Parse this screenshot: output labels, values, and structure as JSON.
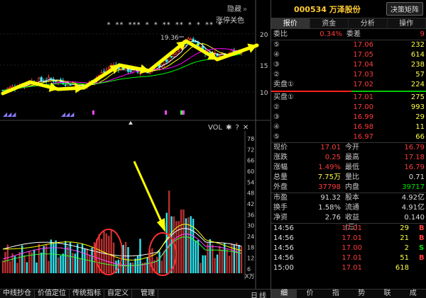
{
  "chart": {
    "hidden_label": "隐藏",
    "limit_label": "涨停关色",
    "stars": "* **  *** * * **  ** *     *     **     *",
    "peak_label": "19.36",
    "price_axis": [
      "20",
      "15",
      "10"
    ],
    "vol_label": "VOL",
    "vol_gear": "✱",
    "vol_q": "?",
    "vol_x": "✕",
    "vol_axis": [
      "78",
      "72",
      "66",
      "60",
      "54",
      "48",
      "42",
      "36",
      "30",
      "24",
      "18",
      "12",
      "6"
    ],
    "vol_unit": "X万"
  },
  "bottom_tabs": [
    "中线抄仓",
    "价值定位",
    "传统指标",
    "自定义",
    "管理"
  ],
  "day_week": [
    "日",
    "线"
  ],
  "panel": {
    "stock_code": "000534",
    "stock_name": "万泽股份",
    "head_button": "决策矩阵",
    "tabs": [
      "报价",
      "资金",
      "分析",
      "操作"
    ],
    "ratio": {
      "label": "委比",
      "value": "0.34%",
      "label2": "委差",
      "value2": "9"
    },
    "asks": [
      {
        "label": "⑤",
        "price": "17.06",
        "vol": "232"
      },
      {
        "label": "④",
        "price": "17.05",
        "vol": "614"
      },
      {
        "label": "③",
        "price": "17.04",
        "vol": "238"
      },
      {
        "label": "②",
        "price": "17.03",
        "vol": "57"
      },
      {
        "label": "卖盘①",
        "price": "17.02",
        "vol": "224"
      }
    ],
    "bids": [
      {
        "label": "买盘①",
        "price": "17.01",
        "vol": "275"
      },
      {
        "label": "②",
        "price": "17.00",
        "vol": "993"
      },
      {
        "label": "③",
        "price": "16.99",
        "vol": "29"
      },
      {
        "label": "④",
        "price": "16.98",
        "vol": "11"
      },
      {
        "label": "⑤",
        "price": "16.97",
        "vol": "66"
      }
    ],
    "quote1": [
      {
        "l1": "现价",
        "v1": "17.01",
        "c1": "red",
        "l2": "今开",
        "v2": "16.79",
        "c2": "red"
      },
      {
        "l1": "涨跌",
        "v1": "0.25",
        "c1": "red",
        "l2": "最高",
        "v2": "17.18",
        "c2": "red"
      },
      {
        "l1": "涨幅",
        "v1": "1.49%",
        "c1": "red",
        "l2": "最低",
        "v2": "16.79",
        "c2": "red"
      },
      {
        "l1": "总量",
        "v1": "7.75万",
        "c1": "yellow",
        "l2": "量比",
        "v2": "0.71",
        "c2": "white"
      },
      {
        "l1": "外盘",
        "v1": "37798",
        "c1": "red",
        "l2": "内盘",
        "v2": "39717",
        "c2": "green"
      }
    ],
    "quote2": [
      {
        "l1": "市盈",
        "v1": "91.32",
        "c1": "white",
        "l2": "股本",
        "v2": "4.92亿",
        "c2": "white"
      },
      {
        "l1": "换手",
        "v1": "1.58%",
        "c1": "white",
        "l2": "流通",
        "v2": "4.91亿",
        "c2": "white"
      },
      {
        "l1": "净资",
        "v1": "2.76",
        "c1": "white",
        "l2": "收益(三)",
        "v2": "0.140",
        "c2": "white"
      }
    ],
    "trades": [
      {
        "time": "14:56",
        "price": "17.01",
        "pc": "red",
        "vol": "29",
        "flag": "B",
        "fc": "red"
      },
      {
        "time": "14:56",
        "price": "17.01",
        "pc": "red",
        "vol": "21",
        "flag": "B",
        "fc": "red"
      },
      {
        "time": "14:56",
        "price": "17.00",
        "pc": "red",
        "vol": "2",
        "flag": "S",
        "fc": "green"
      },
      {
        "time": "14:56",
        "price": "17.01",
        "pc": "red",
        "vol": "51",
        "flag": "B",
        "fc": "red"
      },
      {
        "time": "15:00",
        "price": "17.01",
        "pc": "red",
        "vol": "618",
        "flag": "",
        "fc": "red"
      }
    ],
    "foot_tabs": [
      "细",
      "价",
      "指",
      "势",
      "联",
      "成"
    ]
  },
  "colors": {
    "up": "#ff3b3b",
    "down": "#2ee6f0",
    "ma5": "#ffffff",
    "ma10": "#ffff00",
    "ma20": "#ff00ff",
    "ma60": "#00ff00",
    "arrow": "#ffff00",
    "circle": "#ff3030"
  }
}
